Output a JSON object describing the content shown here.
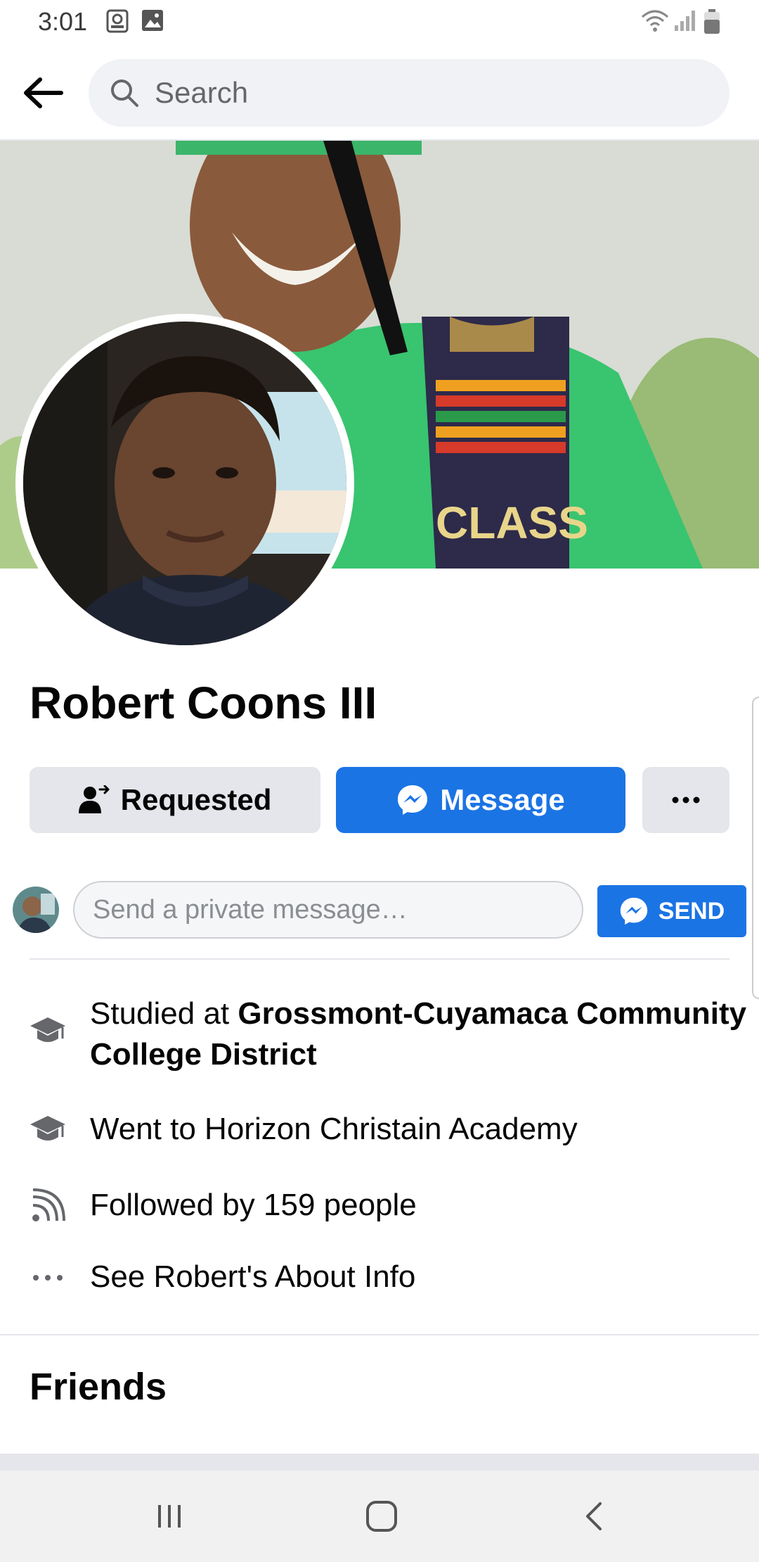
{
  "status_bar": {
    "time": "3:01"
  },
  "search": {
    "placeholder": "Search"
  },
  "profile": {
    "name": "Robert Coons III",
    "cover_caption": "CLASS"
  },
  "actions": {
    "requested_label": "Requested",
    "message_label": "Message",
    "more_label": "..."
  },
  "private_message": {
    "placeholder": "Send a private message…",
    "send_label": "SEND"
  },
  "info": {
    "studied_prefix": "Studied at ",
    "studied_school": "Grossmont-Cuyamaca Community College District",
    "went_to": "Went to Horizon Christain Academy",
    "followed_by": "Followed by 159 people",
    "about_link": "See Robert's About Info"
  },
  "sections": {
    "friends_title": "Friends"
  },
  "colors": {
    "brand_blue": "#1b74e4",
    "button_gray": "#e4e6eb",
    "text_primary": "#050505",
    "text_secondary": "#65676b"
  },
  "icons": [
    "image-icon",
    "cast-icon",
    "wifi-icon",
    "signal-icon",
    "battery-icon",
    "back-arrow-icon",
    "search-icon",
    "add-friend-icon",
    "messenger-icon",
    "more-icon",
    "graduation-cap-icon",
    "rss-icon",
    "recents-icon",
    "home-icon",
    "back-icon"
  ]
}
